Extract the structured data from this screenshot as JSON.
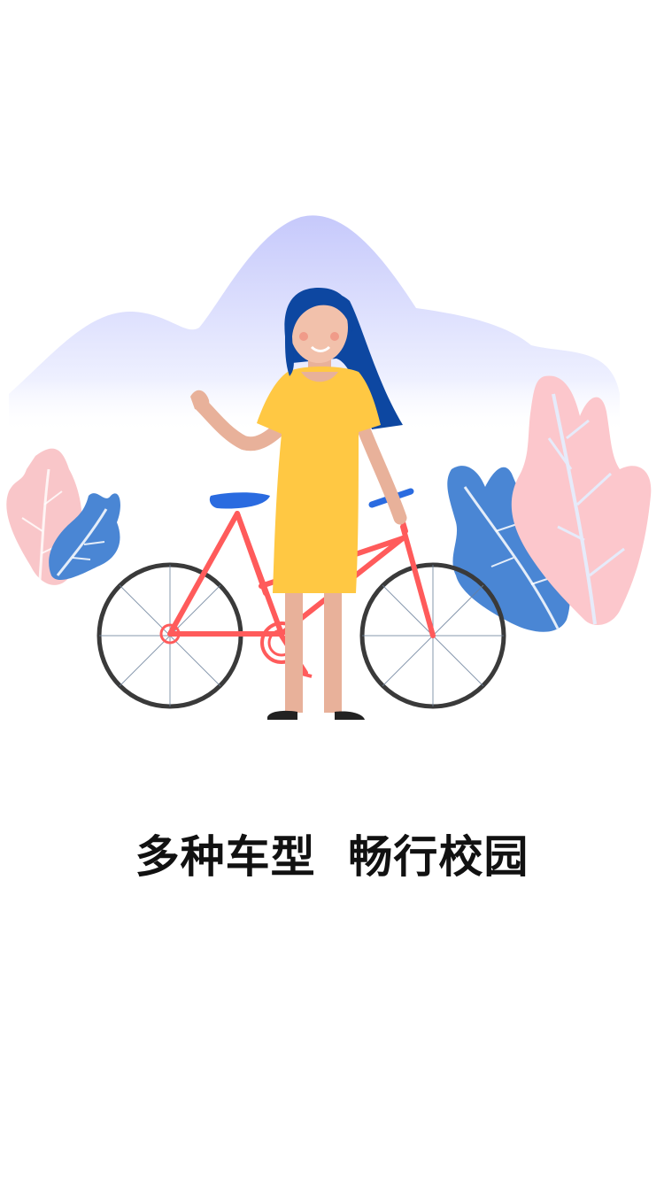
{
  "onboarding": {
    "tagline": "多种车型  畅行校园"
  },
  "colors": {
    "mountain": "#c9ccff",
    "leaf_pink": "#f9c6c9",
    "leaf_blue": "#4a86d4",
    "bike_frame": "#ff5b5b",
    "bike_seat": "#2a6be0",
    "dress": "#ffc843",
    "hair": "#0d47a1",
    "skin": "#e8b19a"
  }
}
